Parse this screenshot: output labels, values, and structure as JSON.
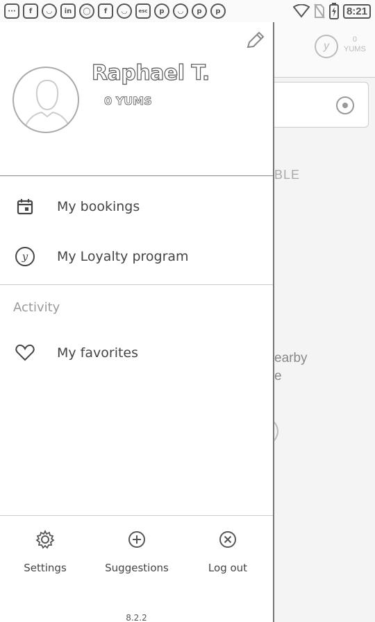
{
  "status_bar": {
    "notification_icons": [
      "message-icon",
      "facebook-icon",
      "pokemon-icon",
      "linkedin-icon",
      "whatsapp-icon",
      "facebook-icon",
      "pokemon-icon",
      "esc-icon",
      "pinterest-icon",
      "pokemon-icon",
      "pinterest-icon",
      "pinterest-icon"
    ],
    "time": "8:21"
  },
  "background_app": {
    "yums_count": "0",
    "yums_label": "YUMS",
    "partial_text_1": "BLE",
    "partial_text_2_line1": "earby",
    "partial_text_2_line2": "e"
  },
  "drawer": {
    "user_name": "Raphael T.",
    "user_yums": "0 YUMS",
    "menu": {
      "bookings_label": "My bookings",
      "loyalty_label": "My Loyalty program",
      "activity_section": "Activity",
      "favorites_label": "My favorites"
    },
    "footer": {
      "settings_label": "Settings",
      "suggestions_label": "Suggestions",
      "logout_label": "Log out",
      "version": "8.2.2"
    }
  }
}
